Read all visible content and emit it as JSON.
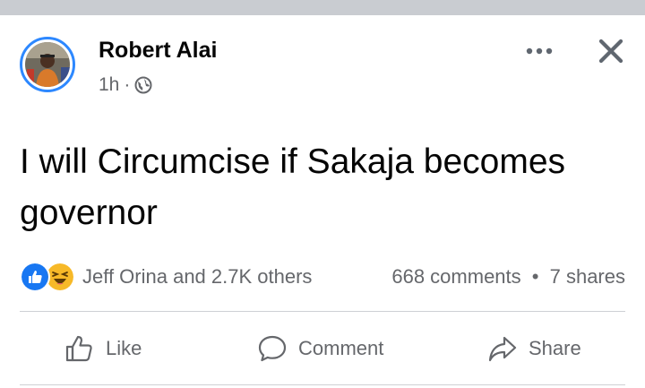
{
  "post": {
    "author": "Robert Alai",
    "time": "1h",
    "separator": "·",
    "text": "I will Circumcise if Sakaja becomes governor",
    "icons": {
      "privacy": "globe-icon",
      "menu": "more-options-icon",
      "close": "close-icon"
    }
  },
  "reactions": {
    "types": [
      "like",
      "haha"
    ],
    "summary": "Jeff Orina and 2.7K others",
    "colors": {
      "like": "#1877f2",
      "haha": "#f7b928"
    }
  },
  "stats": {
    "comments": "668 comments",
    "dot": "•",
    "shares": "7 shares"
  },
  "actions": {
    "like": "Like",
    "comment": "Comment",
    "share": "Share"
  },
  "colors": {
    "accent": "#2d88ff",
    "secondary_text": "#65676b",
    "divider": "#ced0d4",
    "top_bar": "#c9ccd1"
  }
}
